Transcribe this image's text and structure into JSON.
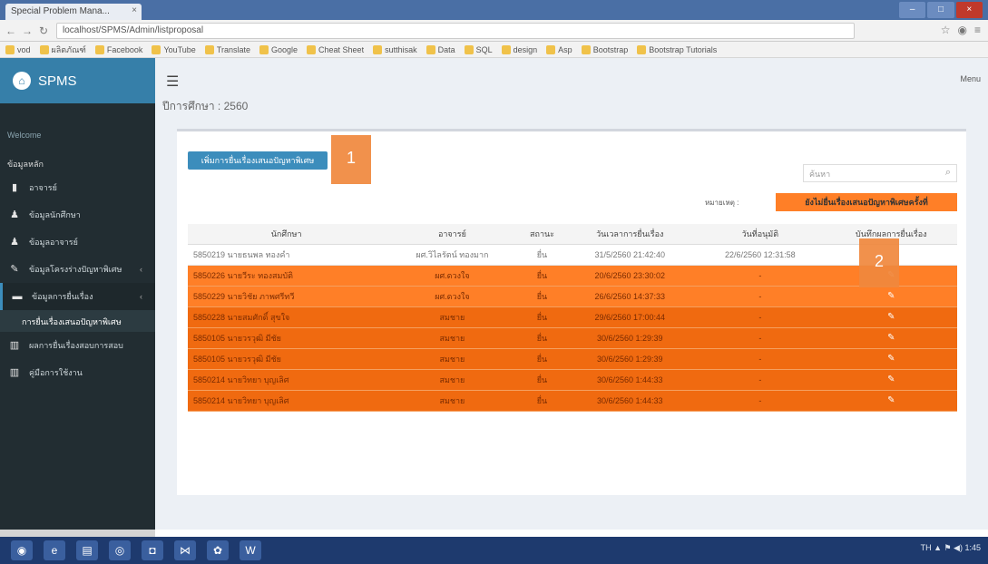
{
  "browser": {
    "tab_title": "Special Problem Mana...",
    "tab_close": "×",
    "url": "localhost/SPMS/Admin/listproposal",
    "bookmarks": [
      "vod",
      "ผลิตภัณฑ์",
      "Facebook",
      "YouTube",
      "Translate",
      "Google",
      "Cheat Sheet",
      "sutthisak",
      "Data",
      "SQL",
      "design",
      "Asp",
      "Bootstrap",
      "Bootstrap Tutorials"
    ]
  },
  "app": {
    "brand": "SPMS",
    "welcome": "Welcome",
    "menu_header": "ข้อมูลหลัก",
    "menu": [
      {
        "label": "อาจารย์",
        "icon": "bookmark-icon"
      },
      {
        "label": "ข้อมูลนักศึกษา",
        "icon": "user-icon"
      },
      {
        "label": "ข้อมูลอาจารย์",
        "icon": "user-icon"
      },
      {
        "label": "ข้อมูลโครงร่างปัญหาพิเศษ",
        "icon": "pencil-icon"
      },
      {
        "label": "ข้อมูลการยื่นเรื่อง",
        "icon": "folder-icon"
      }
    ],
    "submenu_item": "การยื่นเรื่องเสนอปัญหาพิเศษ",
    "menu_after": [
      {
        "label": "ผลการยื่นเรื่องสอบการสอบ",
        "icon": "book-icon"
      },
      {
        "label": "คู่มือการใช้งาน",
        "icon": "book-icon"
      }
    ],
    "topright": "Menu",
    "breadcrumb": "ปีการศึกษา : 2560"
  },
  "toolbar": {
    "add_button": "เพิ่มการยื่นเรื่องเสนอปัญหาพิเศษ",
    "search_placeholder": "ค้นหา",
    "legend_label": "หมายเหตุ :",
    "legend_text": "ยังไม่ยื่นเรื่องเสนอปัญหาพิเศษครั้งที่"
  },
  "badges": {
    "one": "1",
    "two": "2"
  },
  "table": {
    "headers": [
      "นักศึกษา",
      "อาจารย์",
      "สถานะ",
      "วันเวลาการยื่นเรื่อง",
      "วันที่อนุมัติ",
      "บันทึกผลการยื่นเรื่อง"
    ],
    "rows": [
      {
        "student": "5850219 นายธนพล ทองคำ",
        "advisor": "ผศ.วิไลรัตน์ ทองมาก",
        "status": "ยื่น",
        "submitted": "31/5/2560 21:42:40",
        "approved": "22/6/2560 12:31:58",
        "action": "",
        "style": "white"
      },
      {
        "student": "5850226 นายวีระ ทองสมบัติ",
        "advisor": "ผศ.ดวงใจ",
        "status": "ยื่น",
        "submitted": "20/6/2560 23:30:02",
        "approved": "-",
        "action": "✎",
        "style": "orange"
      },
      {
        "student": "5850229 นายวิชัย ภาพศรีทวี",
        "advisor": "ผศ.ดวงใจ",
        "status": "ยื่น",
        "submitted": "26/6/2560 14:37:33",
        "approved": "-",
        "action": "✎",
        "style": "orange"
      },
      {
        "student": "5850228 นายสมศักดิ์ สุขใจ",
        "advisor": "สมชาย",
        "status": "ยื่น",
        "submitted": "29/6/2560 17:00:44",
        "approved": "-",
        "action": "✎",
        "style": "dark"
      },
      {
        "student": "5850105 นายวรวุฒิ มีชัย",
        "advisor": "สมชาย",
        "status": "ยื่น",
        "submitted": "30/6/2560 1:29:39",
        "approved": "-",
        "action": "✎",
        "style": "dark"
      },
      {
        "student": "5850105 นายวรวุฒิ มีชัย",
        "advisor": "สมชาย",
        "status": "ยื่น",
        "submitted": "30/6/2560 1:29:39",
        "approved": "-",
        "action": "✎",
        "style": "dark"
      },
      {
        "student": "5850214 นายวิทยา บุญเลิศ",
        "advisor": "สมชาย",
        "status": "ยื่น",
        "submitted": "30/6/2560 1:44:33",
        "approved": "-",
        "action": "✎",
        "style": "dark"
      },
      {
        "student": "5850214 นายวิทยา บุญเลิศ",
        "advisor": "สมชาย",
        "status": "ยื่น",
        "submitted": "30/6/2560 1:44:33",
        "approved": "-",
        "action": "✎",
        "style": "dark"
      }
    ]
  },
  "taskbar": {
    "tray": "TH  ▲  ⚑  ◀)  1:45"
  }
}
